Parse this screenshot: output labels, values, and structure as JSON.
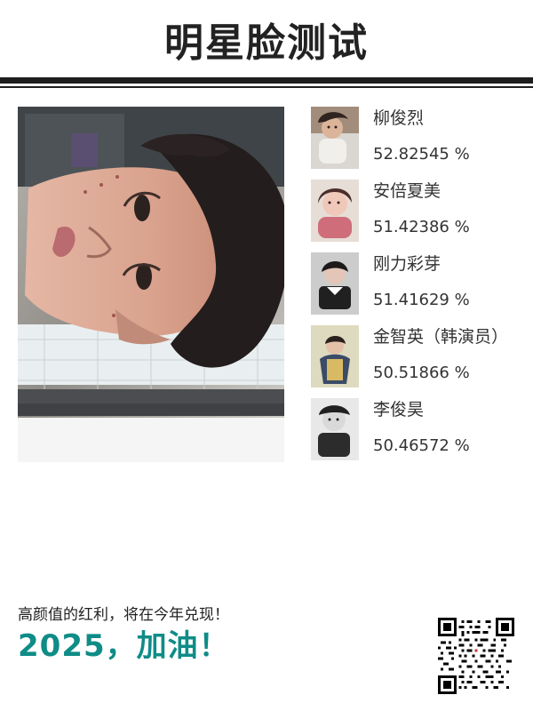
{
  "header": {
    "title": "明星脸测试"
  },
  "user_photo": {
    "subject": "user-face-photo"
  },
  "matches": [
    {
      "name": "柳俊烈",
      "score": "52.82545 %"
    },
    {
      "name": "安倍夏美",
      "score": "51.42386 %"
    },
    {
      "name": "刚力彩芽",
      "score": "51.41629 %"
    },
    {
      "name": "金智英（韩演员）",
      "score": "50.51866 %"
    },
    {
      "name": "李俊昊",
      "score": "50.46572 %"
    }
  ],
  "footer": {
    "line1": "高颜值的红利，将在今年兑现！",
    "line2": "2025，加油！"
  },
  "colors": {
    "accent": "#0f8c87",
    "header_text": "#222222",
    "divider": "#1e1e1e"
  },
  "icons": {
    "qr": "qr-code"
  }
}
